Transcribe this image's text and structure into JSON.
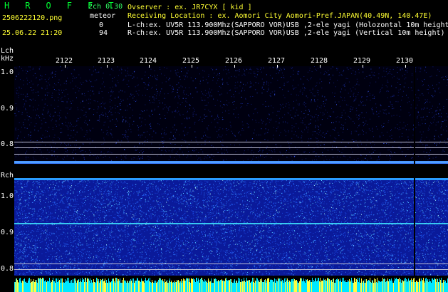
{
  "app_title": "H R O F F T",
  "channels": "2ch 0.30",
  "filename": "2506222120.png",
  "datetime": "25.06.22 21:20",
  "meteor_label": "meteor",
  "meteor_lch": "0",
  "meteor_rch": "94",
  "observer_line": "Ovserver           : ex. JR7CYX [ kid ]",
  "location_line": "Receiving Location : ex. Aomori City Aomori-Pref.JAPAN(40.49N, 140.47E)",
  "lch_line": "L-ch:ex. UV5R 113.900Mhz(SAPPORO VOR)USB ,2-ele yagi (Holozontal 10m height)",
  "rch_line": "R-ch:ex. UV5R 113.900Mhz(SAPPORO VOR)USB ,2-ele yagi (Vertical 10m height)",
  "lch_label": "Lch",
  "khz_label": "kHz",
  "rch_label": "Rch",
  "time_ticks": [
    "2122",
    "2123",
    "2124",
    "2125",
    "2126",
    "2127",
    "2128",
    "2129",
    "2130"
  ],
  "lch_y_ticks": [
    "1.0",
    "0.9",
    "0.8"
  ],
  "rch_y_ticks": [
    "1.0",
    "0.9",
    "0.8"
  ],
  "colors": {
    "title": "#00ff33",
    "yellow": "#ffff33",
    "spectrum_dark": "#000080",
    "spectrum_noise": "#1e50ff",
    "carrier": "#00ffff"
  }
}
